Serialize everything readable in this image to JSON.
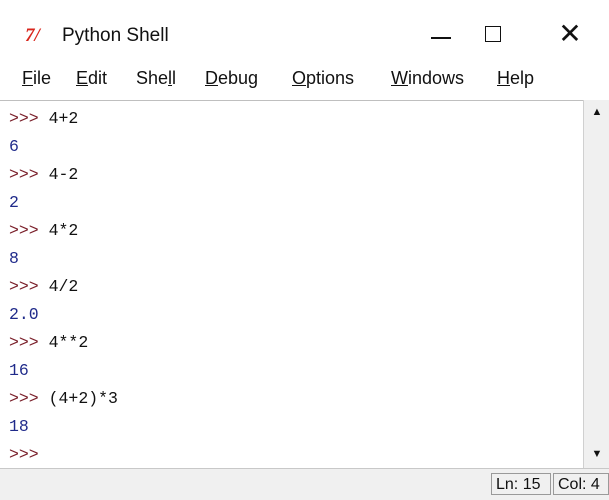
{
  "window": {
    "icon_text": "7/",
    "title": "Python Shell",
    "minimize_symbol": "—",
    "maximize_symbol": "☐",
    "close_symbol": "✕"
  },
  "menu": {
    "items": [
      {
        "label_u": "F",
        "label_rest": "ile"
      },
      {
        "label_u": "E",
        "label_rest": "dit"
      },
      {
        "label_pre": "She",
        "label_u": "l",
        "label_rest": "l"
      },
      {
        "label_u": "D",
        "label_rest": "ebug"
      },
      {
        "label_u": "O",
        "label_rest": "ptions"
      },
      {
        "label_u": "W",
        "label_rest": "indows"
      },
      {
        "label_u": "H",
        "label_rest": "elp"
      }
    ]
  },
  "shell": {
    "prompt": ">>>",
    "lines": [
      {
        "cmd": "4+2",
        "out": "6"
      },
      {
        "cmd": "4-2",
        "out": "2"
      },
      {
        "cmd": "4*2",
        "out": "8"
      },
      {
        "cmd": "4/2",
        "out": "2.0"
      },
      {
        "cmd": "4**2",
        "out": "16"
      },
      {
        "cmd": "(4+2)*3",
        "out": "18"
      },
      {
        "cmd": ""
      }
    ]
  },
  "scrollbar": {
    "up_arrow": "▲",
    "down_arrow": "▼"
  },
  "status": {
    "ln": "Ln: 15",
    "col": "Col: 4"
  }
}
